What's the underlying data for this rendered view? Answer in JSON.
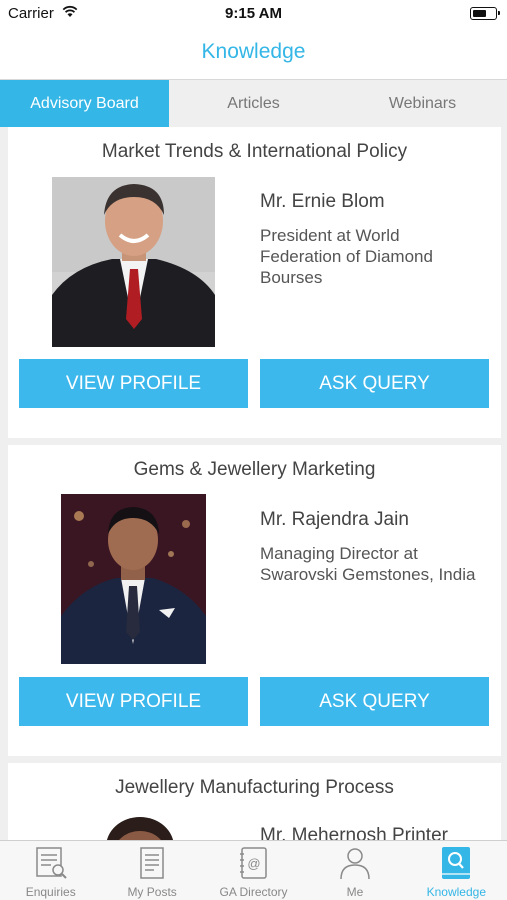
{
  "status_bar": {
    "carrier": "Carrier",
    "time": "9:15 AM"
  },
  "nav": {
    "title": "Knowledge"
  },
  "tabs": [
    {
      "label": "Advisory Board",
      "active": true
    },
    {
      "label": "Articles",
      "active": false
    },
    {
      "label": "Webinars",
      "active": false
    }
  ],
  "advisors": [
    {
      "category": "Market Trends & International Policy",
      "name": "Mr. Ernie Blom",
      "role": "President at World Federation of Diamond Bourses",
      "view_label": "VIEW PROFILE",
      "ask_label": "ASK QUERY"
    },
    {
      "category": "Gems & Jewellery Marketing",
      "name": "Mr. Rajendra Jain",
      "role": "Managing Director at Swarovski Gemstones, India",
      "view_label": "VIEW PROFILE",
      "ask_label": "ASK QUERY"
    },
    {
      "category": "Jewellery Manufacturing Process",
      "name": "Mr. Mehernosh Printer"
    }
  ],
  "tab_bar": [
    {
      "label": "Enquiries",
      "icon": "enquiries-icon",
      "active": false
    },
    {
      "label": "My Posts",
      "icon": "my-posts-icon",
      "active": false
    },
    {
      "label": "GA Directory",
      "icon": "directory-icon",
      "active": false
    },
    {
      "label": "Me",
      "icon": "person-icon",
      "active": false
    },
    {
      "label": "Knowledge",
      "icon": "knowledge-icon",
      "active": true
    }
  ],
  "colors": {
    "accent": "#34b6e6",
    "button": "#3db8ec",
    "background": "#efefef"
  }
}
